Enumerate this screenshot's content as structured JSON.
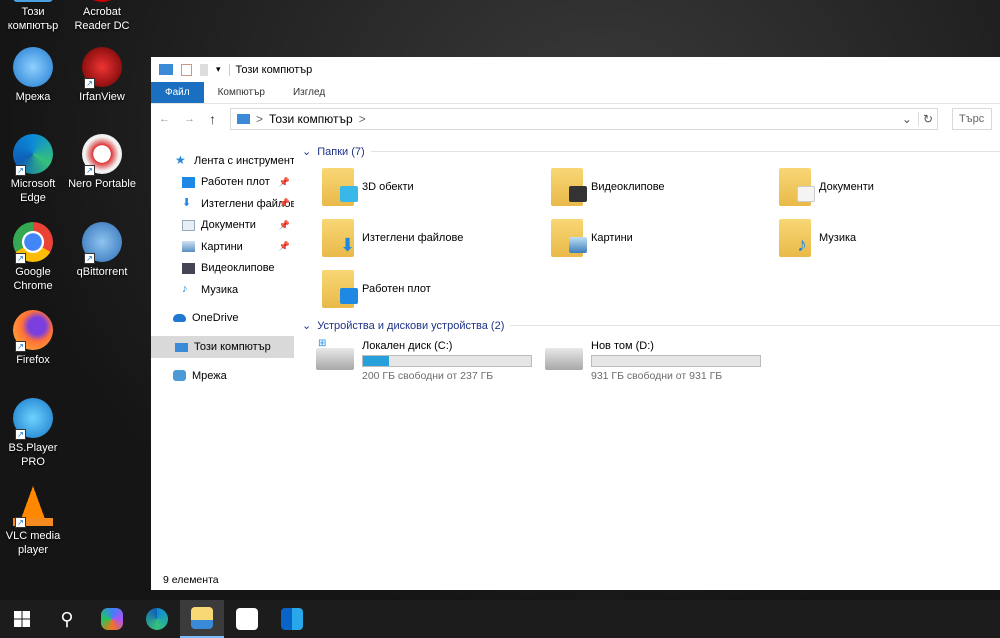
{
  "desktop": {
    "icons": [
      {
        "label": "Този компютър",
        "col": 0
      },
      {
        "label": "Мрежа",
        "col": 0
      },
      {
        "label": "Microsoft Edge",
        "col": 0
      },
      {
        "label": "Google Chrome",
        "col": 0
      },
      {
        "label": "Firefox",
        "col": 0
      },
      {
        "label": "BS.Player PRO",
        "col": 0
      },
      {
        "label": "VLC media player",
        "col": 0
      },
      {
        "label": "Acrobat Reader DC",
        "col": 1
      },
      {
        "label": "IrfanView",
        "col": 1
      },
      {
        "label": "Nero Portable",
        "col": 1
      },
      {
        "label": "qBittorrent",
        "col": 1
      }
    ]
  },
  "window": {
    "title": "Този компютър",
    "dropdown_glyph": "▾",
    "tabs": [
      "Файл",
      "Компютър",
      "Изглед"
    ],
    "address": {
      "path": "Този компютър",
      "sep": ">",
      "search_placeholder": "Търс"
    },
    "nav": {
      "quick_access": "Лента с инструменти",
      "items": [
        {
          "label": "Работен плот",
          "pinned": true
        },
        {
          "label": "Изтеглени файлове",
          "pinned": true
        },
        {
          "label": "Документи",
          "pinned": true
        },
        {
          "label": "Картини",
          "pinned": true
        },
        {
          "label": "Видеоклипове",
          "pinned": false
        },
        {
          "label": "Музика",
          "pinned": false
        }
      ],
      "onedrive": "OneDrive",
      "this_pc": "Този компютър",
      "network": "Мрежа",
      "pin_glyph": "📌"
    },
    "folders_header": "Папки (7)",
    "folders": [
      "3D обекти",
      "Видеоклипове",
      "Документи",
      "Изтеглени файлове",
      "Картини",
      "Музика",
      "Работен плот"
    ],
    "devices_header": "Устройства и дискови устройства (2)",
    "drives": [
      {
        "name": "Локален диск (C:)",
        "free": "200 ГБ свободни от 237 ГБ",
        "used_fraction": 0.156
      },
      {
        "name": "Нов том (D:)",
        "free": "931 ГБ свободни от 931 ГБ",
        "used_fraction": 0.0
      }
    ],
    "status": "9 елемента"
  },
  "colors": {
    "accent": "#1a6fc0",
    "bar": "#26a0da"
  }
}
